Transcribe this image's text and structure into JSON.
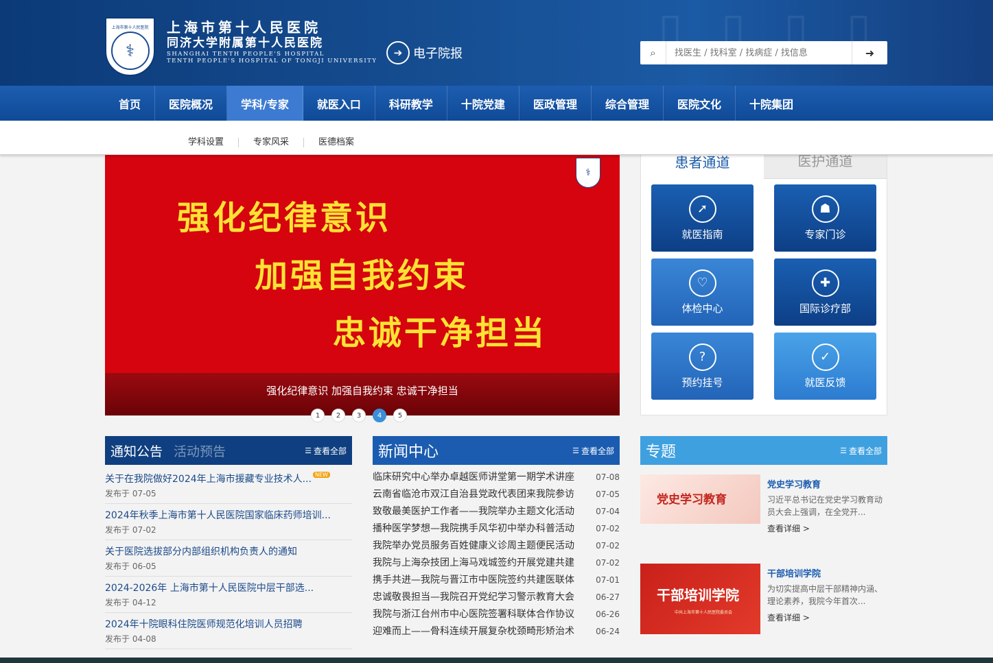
{
  "header": {
    "hospital_cn": "上海市第十人民医院",
    "hospital_cn2": "同济大学附属第十人民医院",
    "hospital_en1": "SHANGHAI TENTH PEOPLE'S HOSPITAL",
    "hospital_en2": "TENTH PEOPLE'S HOSPITAL OF TONGJI UNIVERSITY",
    "seal_caption": "上海市第十人民医院",
    "epaper_label": "电子院报",
    "search_placeholder": "找医生 / 找科室 / 找病症 / 找信息"
  },
  "nav": [
    "首页",
    "医院概况",
    "学科/专家",
    "就医入口",
    "科研教学",
    "十院党建",
    "医政管理",
    "综合管理",
    "医院文化",
    "十院集团"
  ],
  "nav_active": 2,
  "subnav": [
    "学科设置",
    "专家风采",
    "医德档案"
  ],
  "banner": {
    "line1": "强化纪律意识",
    "line2": "加强自我约束",
    "line3": "忠诚干净担当",
    "caption": "强化纪律意识 加强自我约束 忠诚干净担当",
    "dots": [
      "1",
      "2",
      "3",
      "4",
      "5"
    ],
    "active_dot": 4
  },
  "channel": {
    "tab_patient": "患者通道",
    "tab_staff": "医护通道",
    "tiles": [
      {
        "label": "就医指南",
        "icon": "compass-icon",
        "glyph": "➚"
      },
      {
        "label": "专家门诊",
        "icon": "doctor-icon",
        "glyph": "☗"
      },
      {
        "label": "体检中心",
        "icon": "heart-plus-icon",
        "glyph": "♡"
      },
      {
        "label": "国际诊疗部",
        "icon": "globe-cross-icon",
        "glyph": "✚"
      },
      {
        "label": "预约挂号",
        "icon": "question-search-icon",
        "glyph": "?"
      },
      {
        "label": "就医反馈",
        "icon": "thumbs-up-icon",
        "glyph": "👍"
      }
    ]
  },
  "notice": {
    "tab1": "通知公告",
    "tab2": "活动预告",
    "more": "查看全部",
    "new_badge": "NEW",
    "items": [
      {
        "title": "关于在我院做好2024年上海市援藏专业技术人...",
        "date": "发布于 07-05",
        "is_new": true
      },
      {
        "title": "2024年秋季上海市第十人民医院国家临床药师培训...",
        "date": "发布于 07-02",
        "is_new": false
      },
      {
        "title": "关于医院选拔部分内部组织机构负责人的通知",
        "date": "发布于 06-05",
        "is_new": false
      },
      {
        "title": "2024-2026年 上海市第十人民医院中层干部选...",
        "date": "发布于 04-12",
        "is_new": false
      },
      {
        "title": "2024年十院眼科住院医师规范化培训人员招聘",
        "date": "发布于 04-08",
        "is_new": false
      }
    ]
  },
  "news": {
    "title": "新闻中心",
    "more": "查看全部",
    "items": [
      {
        "title": "临床研究中心举办卓越医师讲堂第一期学术讲座",
        "date": "07-08"
      },
      {
        "title": "云南省临沧市双江自治县党政代表团来我院参访",
        "date": "07-05"
      },
      {
        "title": "致敬最美医护工作者——我院举办主题文化活动",
        "date": "07-04"
      },
      {
        "title": "播种医学梦想—我院携手风华初中举办科普活动",
        "date": "07-02"
      },
      {
        "title": "我院举办党员服务百姓健康义诊周主题便民活动",
        "date": "07-02"
      },
      {
        "title": "我院与上海杂技团上海马戏城签约开展党建共建",
        "date": "07-02"
      },
      {
        "title": "携手共进—我院与晋江市中医院签约共建医联体",
        "date": "07-01"
      },
      {
        "title": "忠诚敬畏担当—我院召开党纪学习警示教育大会",
        "date": "06-27"
      },
      {
        "title": "我院与浙江台州市中心医院签署科联体合作协议",
        "date": "06-26"
      },
      {
        "title": "迎难而上——骨科连续开展复杂枕颈畸形矫治术",
        "date": "06-24"
      }
    ]
  },
  "topic": {
    "title": "专题",
    "more": "查看全部",
    "cards": [
      {
        "img_text": "党史学习教育",
        "heading": "党史学习教育",
        "desc": "习近平总书记在党史学习教育动员大会上强调，在全党开...",
        "more": "查看详细 >"
      },
      {
        "img_text": "干部培训学院",
        "img_sub": "中共上海市第十人民医院委员会",
        "heading": "干部培训学院",
        "desc": "为切实提高中层干部精神内涵、理论素养，我院今年首次...",
        "more": "查看详细 >"
      }
    ]
  }
}
